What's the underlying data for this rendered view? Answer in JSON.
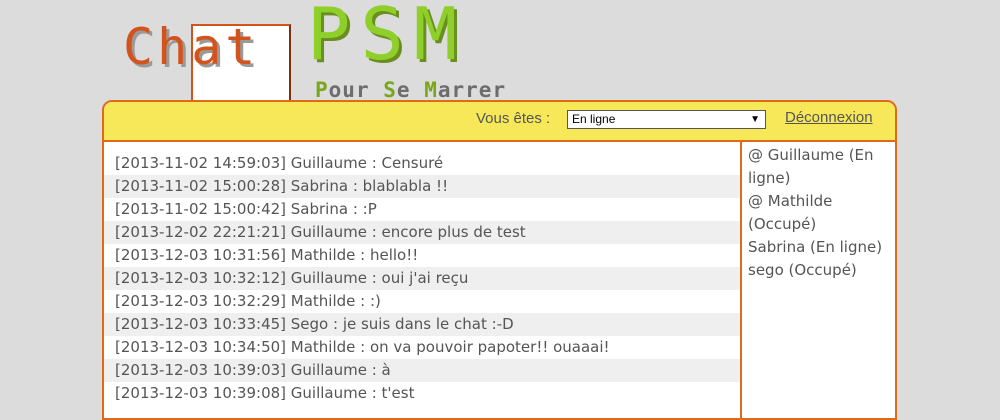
{
  "logo": {
    "chat": "Chat",
    "psm": "PSM",
    "tagline": [
      "Pour",
      "Se",
      "Marrer"
    ]
  },
  "topbar": {
    "status_label": "Vous êtes :",
    "status_value": "En ligne",
    "logout": "Déconnexion"
  },
  "messages": [
    "[2013-11-02 14:59:03] Guillaume : Censuré",
    "[2013-11-02 15:00:28] Sabrina : blablabla !!",
    "[2013-11-02 15:00:42] Sabrina : :P",
    "[2013-12-02 22:21:21] Guillaume : encore plus de test",
    "[2013-12-03 10:31:56] Mathilde : hello!!",
    "[2013-12-03 10:32:12] Guillaume : oui j'ai reçu",
    "[2013-12-03 10:32:29] Mathilde : :)",
    "[2013-12-03 10:33:45] Sego : je suis dans le chat :-D",
    "[2013-12-03 10:34:50] Mathilde : on va pouvoir papoter!! ouaaai!",
    "[2013-12-03 10:39:03] Guillaume : à",
    "[2013-12-03 10:39:08] Guillaume : t'est"
  ],
  "users": [
    "@ Guillaume (En ligne)",
    "@ Mathilde (Occupé)",
    "Sabrina (En ligne)",
    "sego (Occupé)"
  ],
  "colors": {
    "accent": "#e06a1a",
    "topbar": "#f7e85a",
    "logo_green": "#8fcf2a"
  }
}
